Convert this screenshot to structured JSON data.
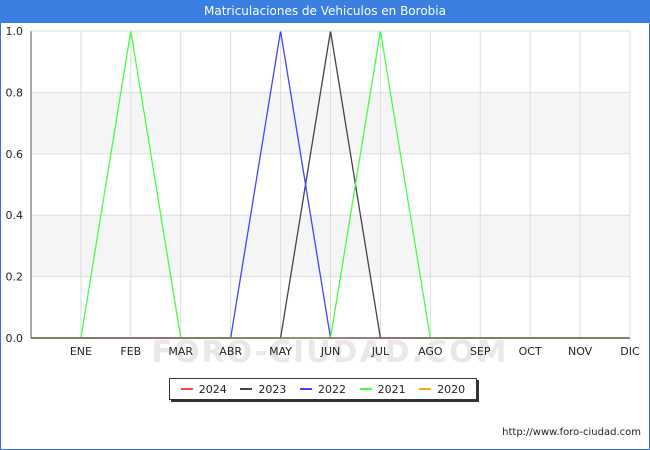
{
  "chart_data": {
    "type": "line",
    "title": "Matriculaciones de Vehiculos en Borobia",
    "xlabel": "",
    "ylabel": "",
    "categories": [
      "",
      "ENE",
      "FEB",
      "MAR",
      "ABR",
      "MAY",
      "JUN",
      "JUL",
      "AGO",
      "SEP",
      "OCT",
      "NOV",
      "DIC"
    ],
    "ylim": [
      0,
      1
    ],
    "yticks": [
      "0.0",
      "0.2",
      "0.4",
      "0.6",
      "0.8",
      "1.0"
    ],
    "grid": true,
    "legend_position": "bottom-center",
    "series": [
      {
        "name": "2024",
        "color": "#ff4444",
        "values": [
          0,
          0,
          0,
          0,
          0,
          0,
          0,
          0,
          0,
          0,
          0,
          0,
          0
        ]
      },
      {
        "name": "2023",
        "color": "#444444",
        "values": [
          0,
          0,
          0,
          0,
          0,
          0,
          1,
          0,
          0,
          0,
          0,
          0,
          0
        ]
      },
      {
        "name": "2022",
        "color": "#4444ff",
        "values": [
          0,
          0,
          0,
          0,
          0,
          1,
          0,
          0,
          0,
          0,
          0,
          0,
          0
        ]
      },
      {
        "name": "2021",
        "color": "#44ff44",
        "values": [
          0,
          0,
          1,
          0,
          0,
          0,
          0,
          1,
          0,
          0,
          0,
          0,
          0
        ]
      },
      {
        "name": "2020",
        "color": "#ffaa00",
        "values": [
          0,
          0,
          0,
          0,
          0,
          0,
          0,
          0,
          0,
          0,
          0,
          0,
          0
        ]
      }
    ]
  },
  "watermark": "FORO-CIUDAD.COM",
  "source_url": "http://www.foro-ciudad.com"
}
